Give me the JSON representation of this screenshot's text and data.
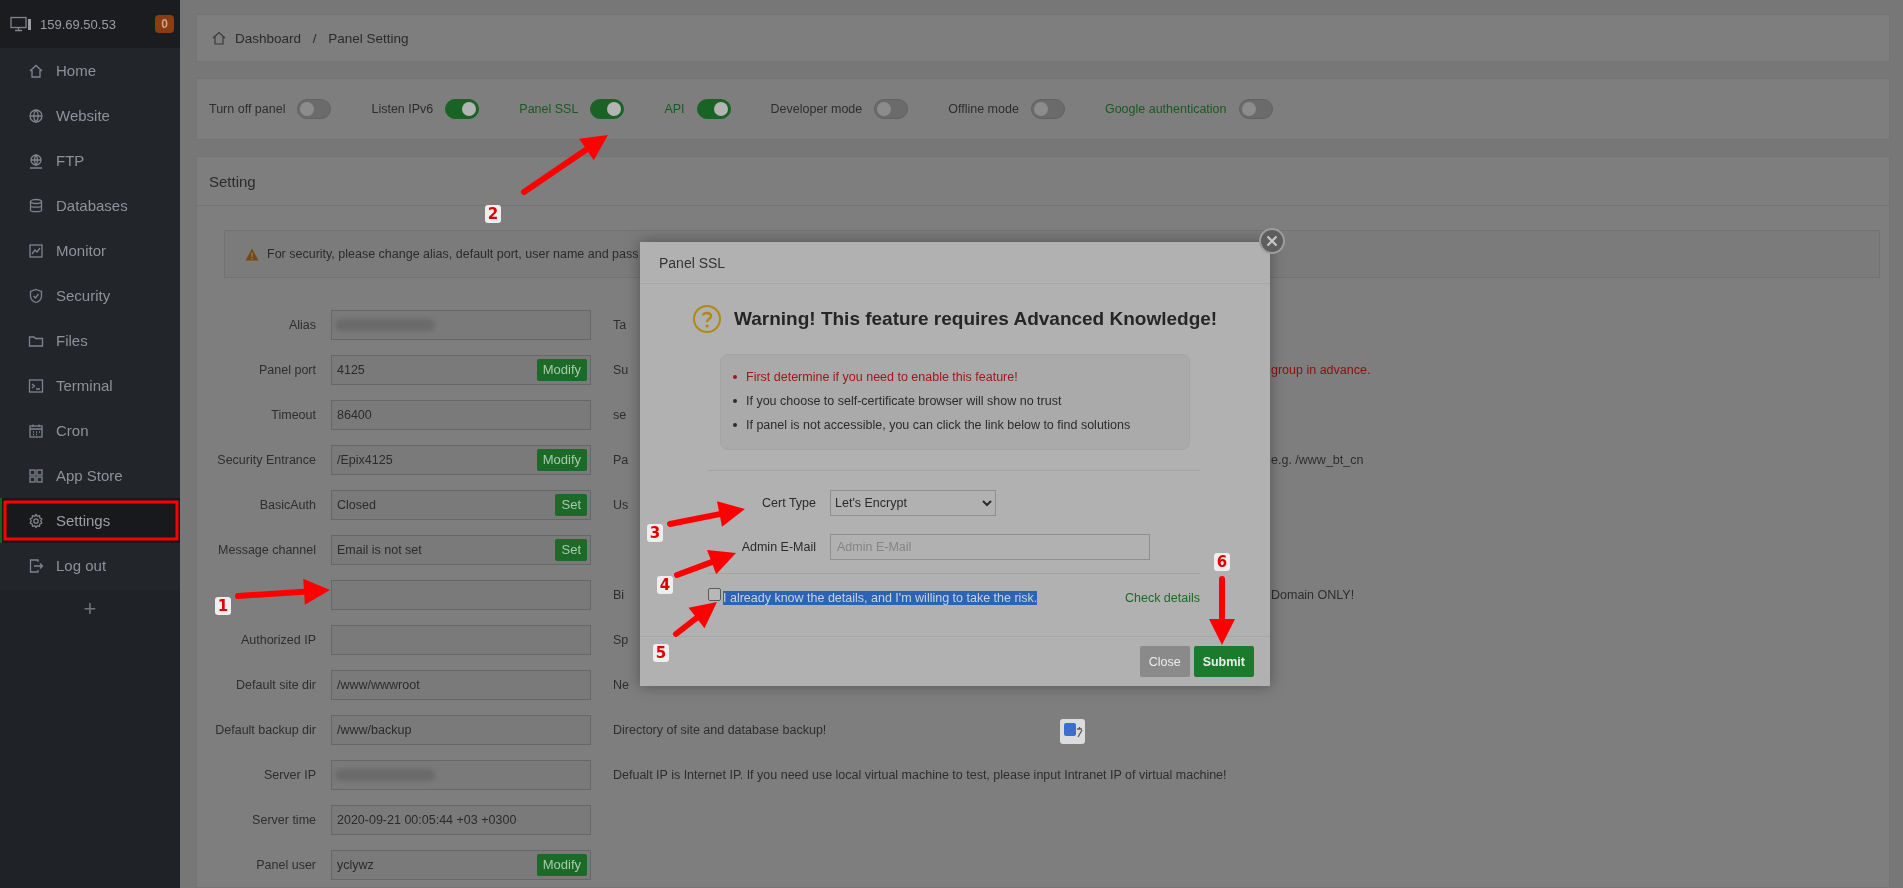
{
  "sidebar": {
    "host": "159.69.50.53",
    "badge": "0",
    "items": [
      {
        "label": "Home",
        "selected": false
      },
      {
        "label": "Website",
        "selected": false
      },
      {
        "label": "FTP",
        "selected": false
      },
      {
        "label": "Databases",
        "selected": false
      },
      {
        "label": "Monitor",
        "selected": false
      },
      {
        "label": "Security",
        "selected": false
      },
      {
        "label": "Files",
        "selected": false
      },
      {
        "label": "Terminal",
        "selected": false
      },
      {
        "label": "Cron",
        "selected": false
      },
      {
        "label": "App Store",
        "selected": false
      },
      {
        "label": "Settings",
        "selected": true
      },
      {
        "label": "Log out",
        "selected": false
      }
    ],
    "add": "+"
  },
  "breadcrumb": {
    "items": [
      "Dashboard",
      "Panel Setting"
    ],
    "separator": "/"
  },
  "toggles": [
    {
      "label": "Turn off panel",
      "on": false,
      "link": false
    },
    {
      "label": "Listen IPv6",
      "on": true,
      "link": false
    },
    {
      "label": "Panel SSL",
      "on": true,
      "link": true
    },
    {
      "label": "API",
      "on": true,
      "link": true
    },
    {
      "label": "Developer mode",
      "on": false,
      "link": false
    },
    {
      "label": "Offline mode",
      "on": false,
      "link": false
    },
    {
      "label": "Google authentication",
      "on": false,
      "link": true
    }
  ],
  "settings": {
    "title": "Setting",
    "notice": "For security, please change alias, default port, user name and pass",
    "rows": [
      {
        "label": "Alias",
        "value": "",
        "redacted": true,
        "hint": "Ta"
      },
      {
        "label": "Panel port",
        "value": "4125",
        "button": "Modify",
        "hint": "Su",
        "hint_tail": "group in advance.",
        "tail_warn": true
      },
      {
        "label": "Timeout",
        "value": "86400",
        "hint": "se"
      },
      {
        "label": "Security Entrance",
        "value": "/Epix4125",
        "button": "Modify",
        "hint": "Pa",
        "hint_tail": "e.g. /www_bt_cn",
        "tail_warn": false
      },
      {
        "label": "BasicAuth",
        "value": "Closed",
        "button": "Set",
        "hint": "Us"
      },
      {
        "label": "Message channel",
        "value": "Email is not set",
        "button": "Set"
      },
      {
        "value": "",
        "hint": "Bi",
        "hint_tail": "Domain ONLY!",
        "tail_warn": false
      },
      {
        "label": "Authorized IP",
        "value": "",
        "hint": "Sp"
      },
      {
        "label": "Default site dir",
        "value": "/www/wwwroot",
        "hint": "Ne"
      },
      {
        "label": "Default backup dir",
        "value": "/www/backup",
        "hint": "Directory of site and database backup!"
      },
      {
        "label": "Server IP",
        "value": "",
        "redacted": true,
        "hint": "Defualt IP is Internet IP. If you need use local virtual machine to test, please input Intranet IP of virtual machine!"
      },
      {
        "label": "Server time",
        "value": "2020-09-21 00:05:44 +03 +0300"
      },
      {
        "label": "Panel user",
        "value": "yclywz",
        "button": "Modify"
      }
    ]
  },
  "modal": {
    "title": "Panel SSL",
    "warning": "Warning! This feature requires Advanced Knowledge!",
    "notes": [
      {
        "text": "First determine if you need to enable this feature!",
        "warn": true
      },
      {
        "text": "If you choose to self-certificate browser will show no trust",
        "warn": false
      },
      {
        "text": "If panel is not accessible, you can click the link below to find solutions",
        "warn": false
      }
    ],
    "cert_type": {
      "label": "Cert Type",
      "value": "Let's Encrypt"
    },
    "email": {
      "label": "Admin E-Mail",
      "placeholder": "Admin E-Mail"
    },
    "consent": {
      "text": "I already know the details, and I'm willing to take the risk.",
      "checked": false,
      "text_selected": true
    },
    "details_link": "Check details",
    "buttons": [
      {
        "label": "Close",
        "disabled": true
      },
      {
        "label": "Submit",
        "disabled": false
      }
    ]
  },
  "annotations": [
    {
      "label": "1"
    },
    {
      "label": "2"
    },
    {
      "label": "3"
    },
    {
      "label": "4"
    },
    {
      "label": "5"
    },
    {
      "label": "6"
    }
  ]
}
